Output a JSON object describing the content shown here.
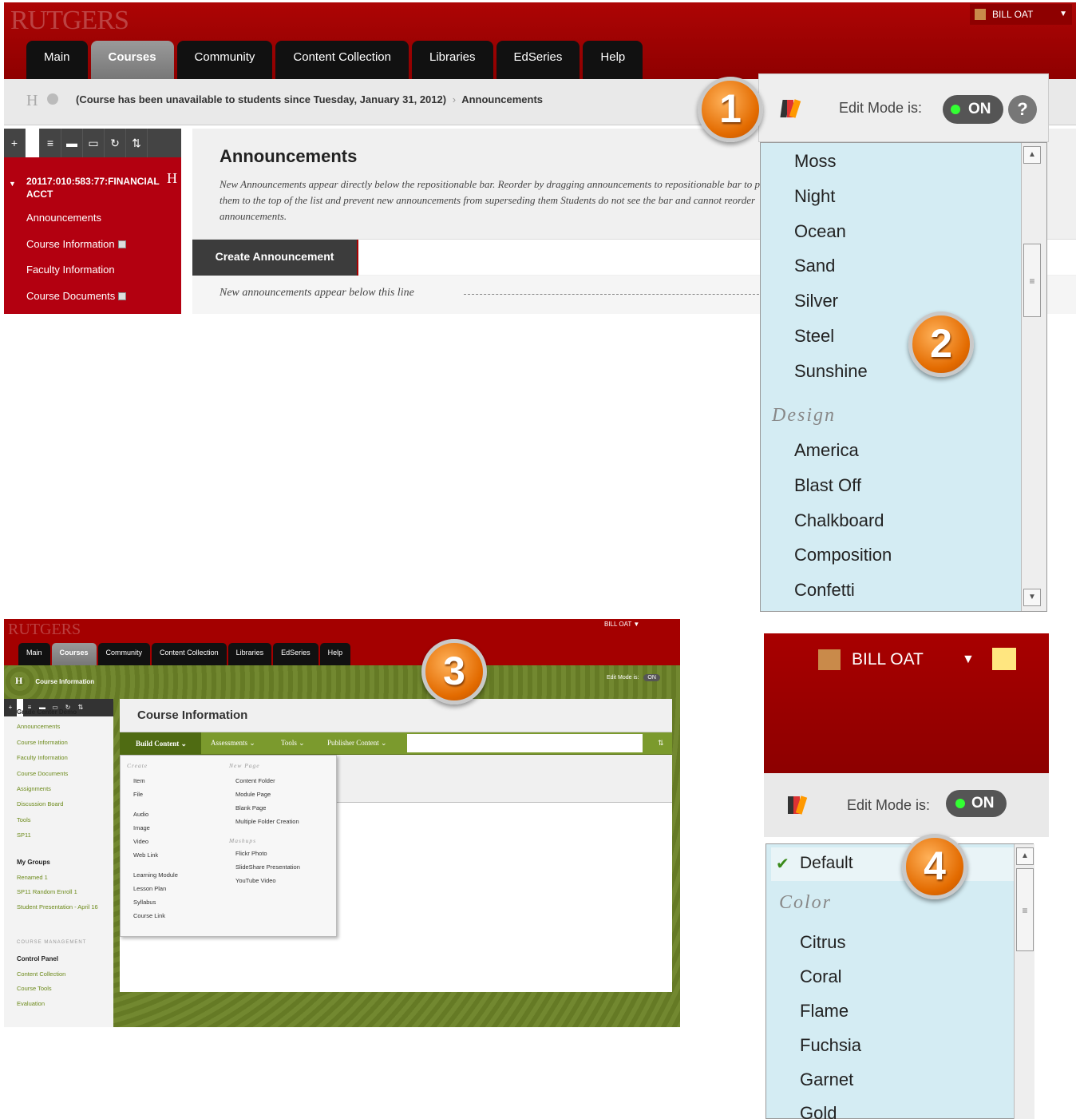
{
  "panel1": {
    "logo": "RUTGERS",
    "user_name": "BILL OAT",
    "tabs": [
      "Main",
      "Courses",
      "Community",
      "Content Collection",
      "Libraries",
      "EdSeries",
      "Help"
    ],
    "breadcrumb_icon": "H",
    "breadcrumb": "(Course has been unavailable to students since Tuesday, January 31, 2012)",
    "breadcrumb_sep": "›",
    "breadcrumb_current": "Announcements",
    "toolbar_icons": [
      "+",
      "≡",
      "▬",
      "▭",
      "↻",
      "⇅"
    ],
    "course_name": "20117:010:583:77:FINANCIAL ACCT",
    "nav": [
      "Announcements",
      "Course Information",
      "Faculty Information",
      "Course Documents"
    ],
    "page_title": "Announcements",
    "description": "New Announcements appear directly below the repositionable bar. Reorder by dragging announcements to repositionable bar to pin them to the top of the list and prevent new announcements from superseding them Students do not see the bar and cannot reorder announcements.",
    "create_button": "Create Announcement",
    "new_line": "New announcements appear below this line"
  },
  "theme_menu_1": {
    "edit_mode_label": "Edit Mode is:",
    "edit_mode_value": "ON",
    "help": "?",
    "items_a": [
      "Moss",
      "Night",
      "Ocean",
      "Sand",
      "Silver",
      "Steel",
      "Sunshine"
    ],
    "category": "Design",
    "items_b": [
      "America",
      "Blast Off",
      "Chalkboard",
      "Composition",
      "Confetti"
    ]
  },
  "badges": [
    "1",
    "2",
    "3",
    "4"
  ],
  "panel3": {
    "logo": "RUTGERS",
    "user_name": "BILL OAT",
    "tabs": [
      "Main",
      "Courses",
      "Community",
      "Content Collection",
      "Libraries",
      "EdSeries",
      "Help"
    ],
    "breadcrumb_icon": "H",
    "breadcrumb": "Course Information",
    "edit_mode": "Edit Mode is:",
    "edit_value": "ON",
    "nav": [
      {
        "label": "Grade Center Demo",
        "type": "h"
      },
      {
        "label": "Announcements",
        "type": "l"
      },
      {
        "label": "Course Information",
        "type": "l"
      },
      {
        "label": "Faculty Information",
        "type": "l"
      },
      {
        "label": "Course Documents",
        "type": "l"
      },
      {
        "label": "Assignments",
        "type": "l"
      },
      {
        "label": "Discussion Board",
        "type": "l"
      },
      {
        "label": "Tools",
        "type": "l"
      },
      {
        "label": "SP11",
        "type": "l"
      },
      {
        "label": "My Groups",
        "type": "h"
      },
      {
        "label": "Renamed 1",
        "type": "l"
      },
      {
        "label": "SP11 Random Enroll 1",
        "type": "l"
      },
      {
        "label": "Student Presentation - April 16",
        "type": "l"
      },
      {
        "label": "COURSE MANAGEMENT",
        "type": "m"
      },
      {
        "label": "Control Panel",
        "type": "h"
      },
      {
        "label": "Content Collection",
        "type": "l"
      },
      {
        "label": "Course Tools",
        "type": "l"
      },
      {
        "label": "Evaluation",
        "type": "l"
      }
    ],
    "page_title": "Course Information",
    "action_bar": [
      "Build Content ⌄",
      "Assessments ⌄",
      "Tools ⌄",
      "Publisher Content ⌄"
    ],
    "sort_icon": "⇅",
    "menu_create_heading": "Create",
    "menu_create": [
      "Item",
      "File",
      "Audio",
      "Image",
      "Video",
      "Web Link",
      "Learning Module",
      "Lesson Plan",
      "Syllabus",
      "Course Link"
    ],
    "menu_newpage_heading": "New Page",
    "menu_newpage": [
      "Content Folder",
      "Module Page",
      "Blank Page",
      "Multiple Folder Creation"
    ],
    "menu_mashups_heading": "Mashups",
    "menu_mashups": [
      "Flickr Photo",
      "SlideShare Presentation",
      "YouTube Video"
    ]
  },
  "panel4": {
    "user_name": "BILL OAT",
    "edit_mode_label": "Edit Mode is:",
    "edit_mode_value": "ON",
    "default_item": "Default",
    "category": "Color",
    "items": [
      "Citrus",
      "Coral",
      "Flame",
      "Fuchsia",
      "Garnet",
      "Gold"
    ]
  }
}
